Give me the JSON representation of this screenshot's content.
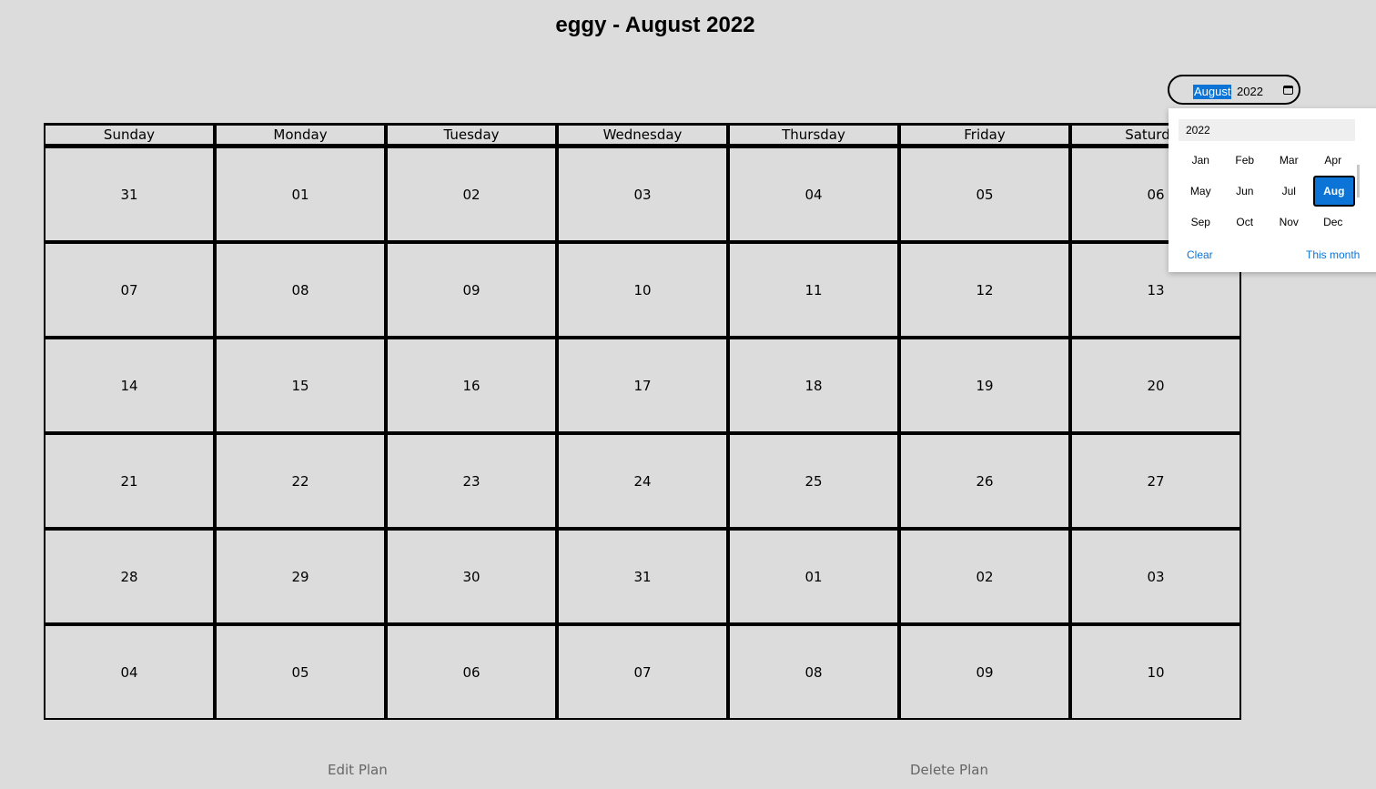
{
  "header": {
    "title": "eggy - August 2022"
  },
  "month_input": {
    "month_text": "August",
    "year_text": "2022",
    "icon": "calendar-icon"
  },
  "weekdays": [
    "Sunday",
    "Monday",
    "Tuesday",
    "Wednesday",
    "Thursday",
    "Friday",
    "Saturday"
  ],
  "weeks": [
    [
      "31",
      "01",
      "02",
      "03",
      "04",
      "05",
      "06"
    ],
    [
      "07",
      "08",
      "09",
      "10",
      "11",
      "12",
      "13"
    ],
    [
      "14",
      "15",
      "16",
      "17",
      "18",
      "19",
      "20"
    ],
    [
      "21",
      "22",
      "23",
      "24",
      "25",
      "26",
      "27"
    ],
    [
      "28",
      "29",
      "30",
      "31",
      "01",
      "02",
      "03"
    ],
    [
      "04",
      "05",
      "06",
      "07",
      "08",
      "09",
      "10"
    ]
  ],
  "picker": {
    "year": "2022",
    "months": [
      "Jan",
      "Feb",
      "Mar",
      "Apr",
      "May",
      "Jun",
      "Jul",
      "Aug",
      "Sep",
      "Oct",
      "Nov",
      "Dec"
    ],
    "selected": "Aug",
    "clear_label": "Clear",
    "this_month_label": "This month"
  },
  "actions": {
    "edit_label": "Edit Plan",
    "delete_label": "Delete Plan"
  },
  "colors": {
    "background": "#dcdcdc",
    "accent": "#0b74d6",
    "grid": "#000000"
  }
}
